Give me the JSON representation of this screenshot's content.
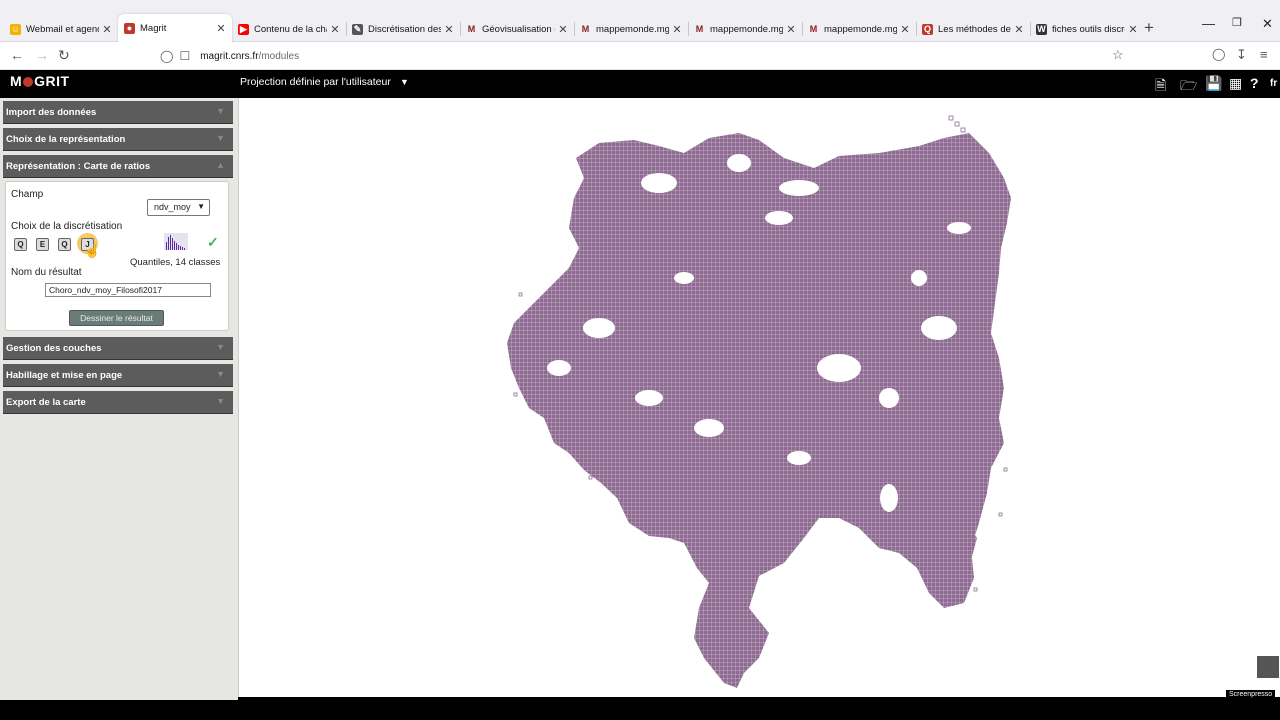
{
  "browser": {
    "tabs": [
      {
        "title": "Webmail et agenda - ",
        "favicon_color": "#f5b000",
        "favicon": "smiley-icon"
      },
      {
        "title": "Magrit",
        "favicon_color": "#c03a2b",
        "favicon": "magrit-icon",
        "active": true
      },
      {
        "title": "Contenu de la chaîne",
        "favicon_color": "#ff0000",
        "favicon": "youtube-icon"
      },
      {
        "title": "Discrétisation des do",
        "favicon_color": "#555555",
        "favicon": "doc-icon"
      },
      {
        "title": "Géovisualisation des",
        "favicon_color": "#8a1c1c",
        "favicon": "m-icon"
      },
      {
        "title": "mappemonde.mgm.",
        "favicon_color": "#8a1c1c",
        "favicon": "m-icon"
      },
      {
        "title": "mappemonde.mgm.",
        "favicon_color": "#8a1c1c",
        "favicon": "m-icon"
      },
      {
        "title": "mappemonde.mgm.",
        "favicon_color": "#8a1c1c",
        "favicon": "m-icon"
      },
      {
        "title": "Les méthodes de disc",
        "favicon_color": "#c03a2b",
        "favicon": "q-icon"
      },
      {
        "title": "fiches outils discrétis",
        "favicon_color": "#333333",
        "favicon": "w-icon"
      }
    ],
    "url_domain": "magrit.cnrs.fr",
    "url_path": "/modules"
  },
  "app": {
    "logo": {
      "pre": "M",
      "post": "GRIT"
    },
    "projection_label": "Projection définie par l'utilisateur",
    "lang": "fr"
  },
  "sidebar": {
    "sections": [
      {
        "label": "Import des données"
      },
      {
        "label": "Choix de la représentation"
      },
      {
        "label": "Représentation : Carte de ratios"
      },
      {
        "label": "Gestion des couches"
      },
      {
        "label": "Habillage et mise en page"
      },
      {
        "label": "Export de la carte"
      }
    ],
    "representation": {
      "field_label": "Champ",
      "field_value": "ndv_moy",
      "discretization_label": "Choix de la discrétisation",
      "disc_buttons": [
        "Q",
        "E",
        "Q",
        "J"
      ],
      "discretization_summary": "Quantiles, 14 classes",
      "result_name_label": "Nom du résultat",
      "result_name_value": "Choro_ndv_moy_Filosofi2017",
      "draw_button": "Dessiner le résultat"
    }
  },
  "map": {
    "fill_color": "#8e6b92",
    "grid_color": "#ffffff"
  },
  "watermark": "Screenpresso"
}
